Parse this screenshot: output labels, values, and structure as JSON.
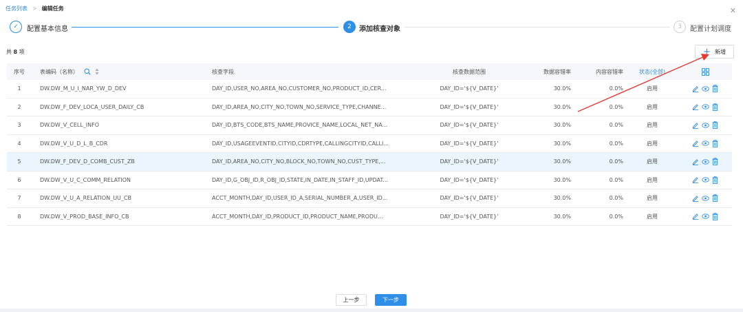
{
  "breadcrumb": {
    "parent": "任务列表",
    "separator": ">",
    "current": "编辑任务"
  },
  "steps": [
    {
      "label": "配置基本信息",
      "status": "done",
      "marker": "✓"
    },
    {
      "label": "添加核查对象",
      "status": "active",
      "marker": "2"
    },
    {
      "label": "配置计划调度",
      "status": "wait",
      "marker": "3"
    }
  ],
  "total": {
    "prefix": "共",
    "count": "8",
    "suffix": "项"
  },
  "add_button": {
    "label": "新增"
  },
  "table": {
    "headers": {
      "index": "序号",
      "code": "表编码（名称）",
      "field": "核查字段",
      "range": "核查数据范围",
      "data_tolerance": "数据容错率",
      "content_tolerance": "内容容错率",
      "status": "状态(全部)"
    },
    "rows": [
      {
        "index": "1",
        "code": "DW.DW_M_U_I_NAR_YW_D_DEV",
        "field": "DAY_ID,USER_NO,AREA_NO,CUSTOMER_NO,PRODUCT_ID,CER...",
        "range": "DAY_ID='${V_DATE}'",
        "data_tol": "30.0%",
        "content_tol": "0.0%",
        "status": "启用"
      },
      {
        "index": "2",
        "code": "DW.DW_F_DEV_LOCA_USER_DAILY_CB",
        "field": "DAY_ID,AREA_NO,CITY_NO,TOWN_NO,SERVICE_TYPE,CHANNE...",
        "range": "DAY_ID='${V_DATE}'",
        "data_tol": "30.0%",
        "content_tol": "0.0%",
        "status": "启用"
      },
      {
        "index": "3",
        "code": "DW.DW_V_CELL_INFO",
        "field": "DAY_ID,BTS_CODE,BTS_NAME,PROVICE_NAME,LOCAL_NET_NA...",
        "range": "DAY_ID='${V_DATE}'",
        "data_tol": "30.0%",
        "content_tol": "0.0%",
        "status": "启用"
      },
      {
        "index": "4",
        "code": "DW.DW_V_U_D_L_B_CDR",
        "field": "DAY_ID,USAGEEVENTID,CITYID,CDRTYPE,CALLINGCITYID,CALLI...",
        "range": "DAY_ID='${V_DATE}'",
        "data_tol": "30.0%",
        "content_tol": "0.0%",
        "status": "启用"
      },
      {
        "index": "5",
        "code": "DW.DW_F_DEV_D_COMB_CUST_ZB",
        "field": "DAY_ID,AREA_NO,CITY_NO,BLOCK_NO,TOWN_NO,CUST_TYPE,...",
        "range": "DAY_ID='${V_DATE}'",
        "data_tol": "30.0%",
        "content_tol": "0.0%",
        "status": "启用"
      },
      {
        "index": "6",
        "code": "DW.DW_V_U_C_COMM_RELATION",
        "field": "DAY_ID,G_OBJ_ID,R_OBJ_ID,STATE,IN_DATE,IN_STAFF_ID,UPDAT...",
        "range": "DAY_ID='${V_DATE}'",
        "data_tol": "30.0%",
        "content_tol": "0.0%",
        "status": "启用"
      },
      {
        "index": "7",
        "code": "DW.DW_V_U_A_RELATION_UU_CB",
        "field": "ACCT_MONTH,DAY_ID,USER_ID_A,SERIAL_NUMBER_A,USER_ID...",
        "range": "DAY_ID='${V_DATE}'",
        "data_tol": "30.0%",
        "content_tol": "0.0%",
        "status": "启用"
      },
      {
        "index": "8",
        "code": "DW.DW_V_PROD_BASE_INFO_CB",
        "field": "ACCT_MONTH,DAY_ID,PRODUCT_ID,PRODUCT_NAME,PRODU...",
        "range": "DAY_ID='${V_DATE}'",
        "data_tol": "30.0%",
        "content_tol": "0.0%",
        "status": "启用"
      }
    ]
  },
  "footer": {
    "prev_label": "上一步",
    "next_label": "下一步"
  },
  "colors": {
    "accent": "#2f8ee6",
    "highlight_row": "#eaf5fd",
    "annotation_arrow": "#e53935"
  }
}
